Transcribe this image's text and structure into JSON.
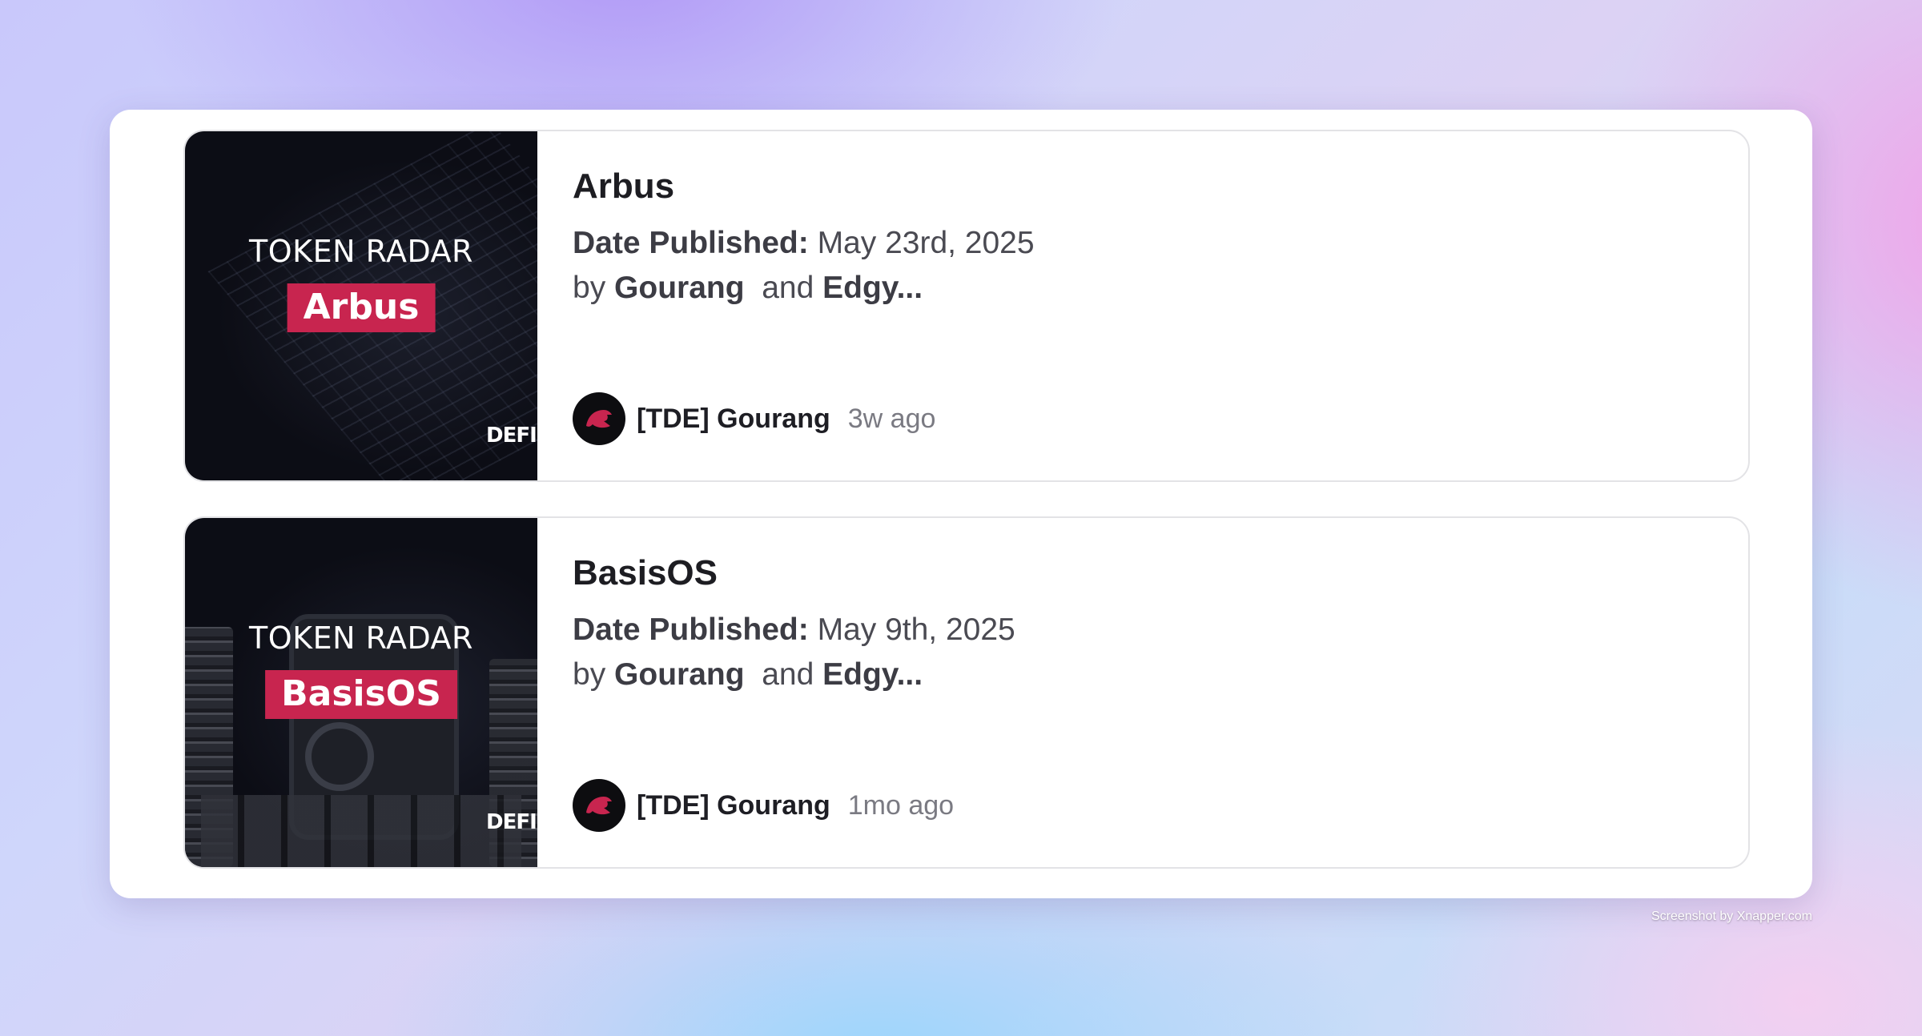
{
  "articles": [
    {
      "thumb_title": "TOKEN RADAR",
      "thumb_badge": "Arbus",
      "thumb_logo": "DEFI",
      "title": "Arbus",
      "date_label": "Date Published:",
      "date_value": "May 23rd, 2025",
      "by_prefix": "by",
      "author_1": "Gourang",
      "and_text": "and",
      "author_2": "Edgy...",
      "poster": "[TDE] Gourang",
      "time_ago": "3w ago"
    },
    {
      "thumb_title": "TOKEN RADAR",
      "thumb_badge": "BasisOS",
      "thumb_logo": "DEFI",
      "title": "BasisOS",
      "date_label": "Date Published:",
      "date_value": "May 9th, 2025",
      "by_prefix": "by",
      "author_1": "Gourang",
      "and_text": "and",
      "author_2": "Edgy...",
      "poster": "[TDE] Gourang",
      "time_ago": "1mo ago"
    }
  ],
  "watermark": "Screenshot by Xnapper.com",
  "colors": {
    "accent": "#c8254f",
    "panel": "#ffffff"
  },
  "icons": {
    "avatar": "dragon-logo-icon"
  }
}
